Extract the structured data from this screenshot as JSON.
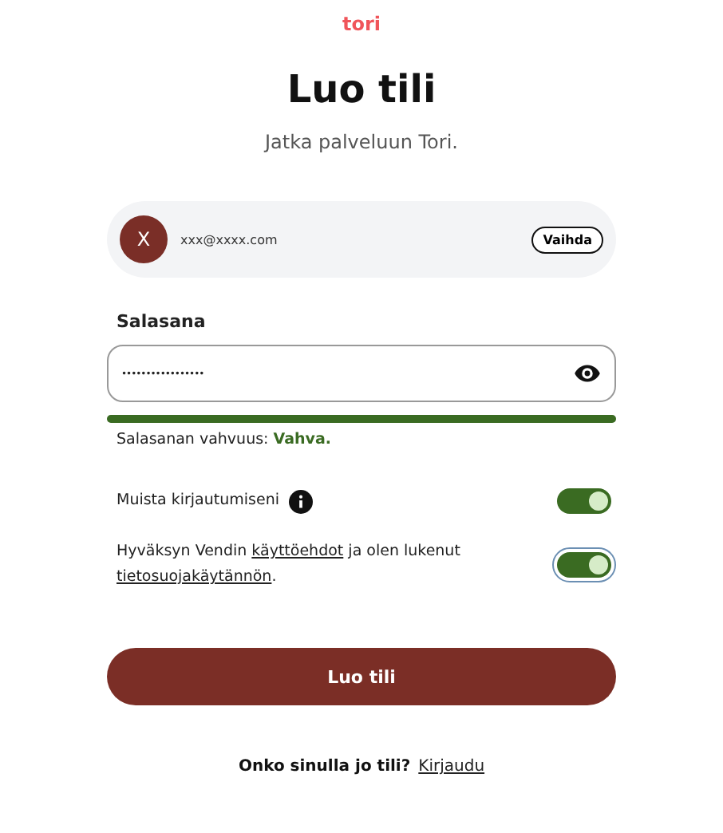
{
  "logo": "tori",
  "title": "Luo tili",
  "subtitle": "Jatka palveluun Tori.",
  "account": {
    "initial": "X",
    "email": "xxx@xxxx.com",
    "change_button": "Vaihda"
  },
  "password": {
    "label": "Salasana",
    "value": "•••••••••••••••••",
    "level": 1,
    "strength_label": "Salasanan vahvuus:",
    "strength_value": "Vahva."
  },
  "toggles": [
    {
      "on": true,
      "focused": false,
      "segments": [
        {
          "kind": "text",
          "text": "Muista kirjautumiseni"
        },
        {
          "kind": "info"
        }
      ]
    },
    {
      "on": true,
      "focused": true,
      "segments": [
        {
          "kind": "text",
          "text": "Hyväksyn Vendin "
        },
        {
          "kind": "link",
          "text": "käyttöehdot"
        },
        {
          "kind": "text",
          "text": " ja olen lukenut "
        },
        {
          "kind": "link",
          "text": "tietosuojakäytännön"
        },
        {
          "kind": "text",
          "text": "."
        }
      ]
    }
  ],
  "submit_button": "Luo tili",
  "footer": {
    "question": "Onko sinulla jo tili?",
    "link": "Kirjaudu"
  }
}
